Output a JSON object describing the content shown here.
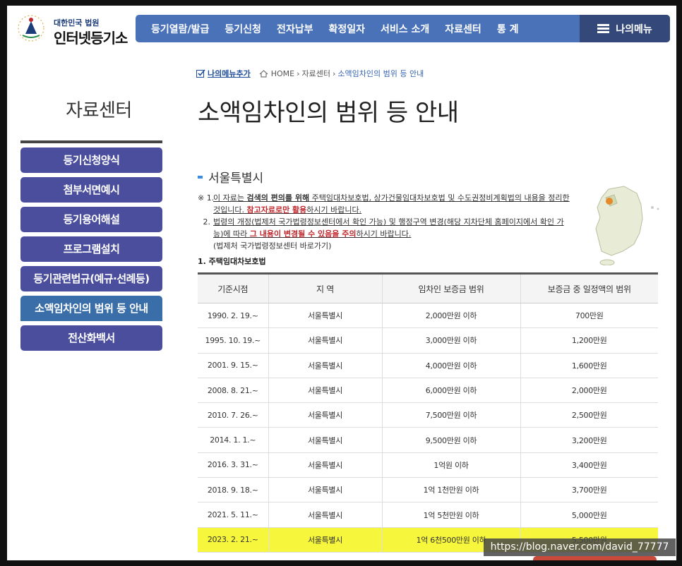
{
  "header": {
    "logo_court": "대한민국 법원",
    "logo_name": "인터넷등기소",
    "nav": [
      "등기열람/발급",
      "등기신청",
      "전자납부",
      "확정일자",
      "서비스 소개",
      "자료센터",
      "통 계"
    ],
    "my_menu": "나의메뉴"
  },
  "sidebar": {
    "title": "자료센터",
    "items": [
      {
        "label": "등기신청양식"
      },
      {
        "label": "첨부서면예시"
      },
      {
        "label": "등기용어해설"
      },
      {
        "label": "프로그램설치"
      },
      {
        "label": "등기관련법규(예규·선례등)"
      },
      {
        "label": "소액임차인의 범위 등 안내"
      },
      {
        "label": "전산화백서"
      }
    ],
    "active_index": 5
  },
  "breadcrumb": {
    "add_menu": "나의메뉴추가",
    "home": "HOME",
    "parent": "자료센터",
    "current": "소액임차인의 범위 등 안내"
  },
  "page": {
    "title": "소액임차인의 범위 등 안내",
    "region": "서울특별시",
    "notes": {
      "marker1": "※ 1.",
      "n1_a": "이 자료는 ",
      "n1_b": "검색의 편의를 위해",
      "n1_c": " 주택임대차보호법, 상가건물임대차보호법 및 수도권정비계획법의 내용을 정리한 것입니다. ",
      "n1_d": "참고자료로만 활용",
      "n1_e": "하시기 바랍니다.",
      "marker2": "2.",
      "n2_a": "법령의 개정(법제처 국가법령정보센터에서 확인 가능) 및 행정구역 변경(해당 지차단체 홈페이지에서 확인 가능)에 따라 ",
      "n2_b": "그 내용이 변경될 수 있음을 주의",
      "n2_c": "하시기 바랍니다.",
      "link": "(법제처 국가법령정보센터 바로가기)"
    },
    "section": "1. 주택임대차보호법"
  },
  "table": {
    "headers": [
      "기준시점",
      "지 역",
      "임차인 보증금 범위",
      "보증금 중 일정액의 범위"
    ],
    "rows": [
      [
        "1990. 2. 19.~",
        "서울특별시",
        "2,000만원 이하",
        "700만원"
      ],
      [
        "1995. 10. 19.~",
        "서울특별시",
        "3,000만원 이하",
        "1,200만원"
      ],
      [
        "2001. 9. 15.~",
        "서울특별시",
        "4,000만원 이하",
        "1,600만원"
      ],
      [
        "2008. 8. 21.~",
        "서울특별시",
        "6,000만원 이하",
        "2,000만원"
      ],
      [
        "2010. 7. 26.~",
        "서울특별시",
        "7,500만원 이하",
        "2,500만원"
      ],
      [
        "2014. 1. 1.~",
        "서울특별시",
        "9,500만원 이하",
        "3,200만원"
      ],
      [
        "2016. 3. 31.~",
        "서울특별시",
        "1억원 이하",
        "3,400만원"
      ],
      [
        "2018. 9. 18.~",
        "서울특별시",
        "1억 1천만원 이하",
        "3,700만원"
      ],
      [
        "2021. 5. 11.~",
        "서울특별시",
        "1억 5천만원 이하",
        "5,000만원"
      ],
      [
        "2023. 2. 21.~",
        "서울특별시",
        "1억 6천500만원 이하",
        "5,500만원"
      ]
    ],
    "highlight_row": 9
  },
  "watermark": "https://blog.naver.com/david_77777",
  "colors": {
    "nav_bg": "#4a72b8",
    "my_menu_bg": "#34497a",
    "sidebar_btn": "#4a4e9c",
    "sidebar_active": "#3a6ea8",
    "highlight": "#f6f63c",
    "warn_red": "#c0282d"
  }
}
